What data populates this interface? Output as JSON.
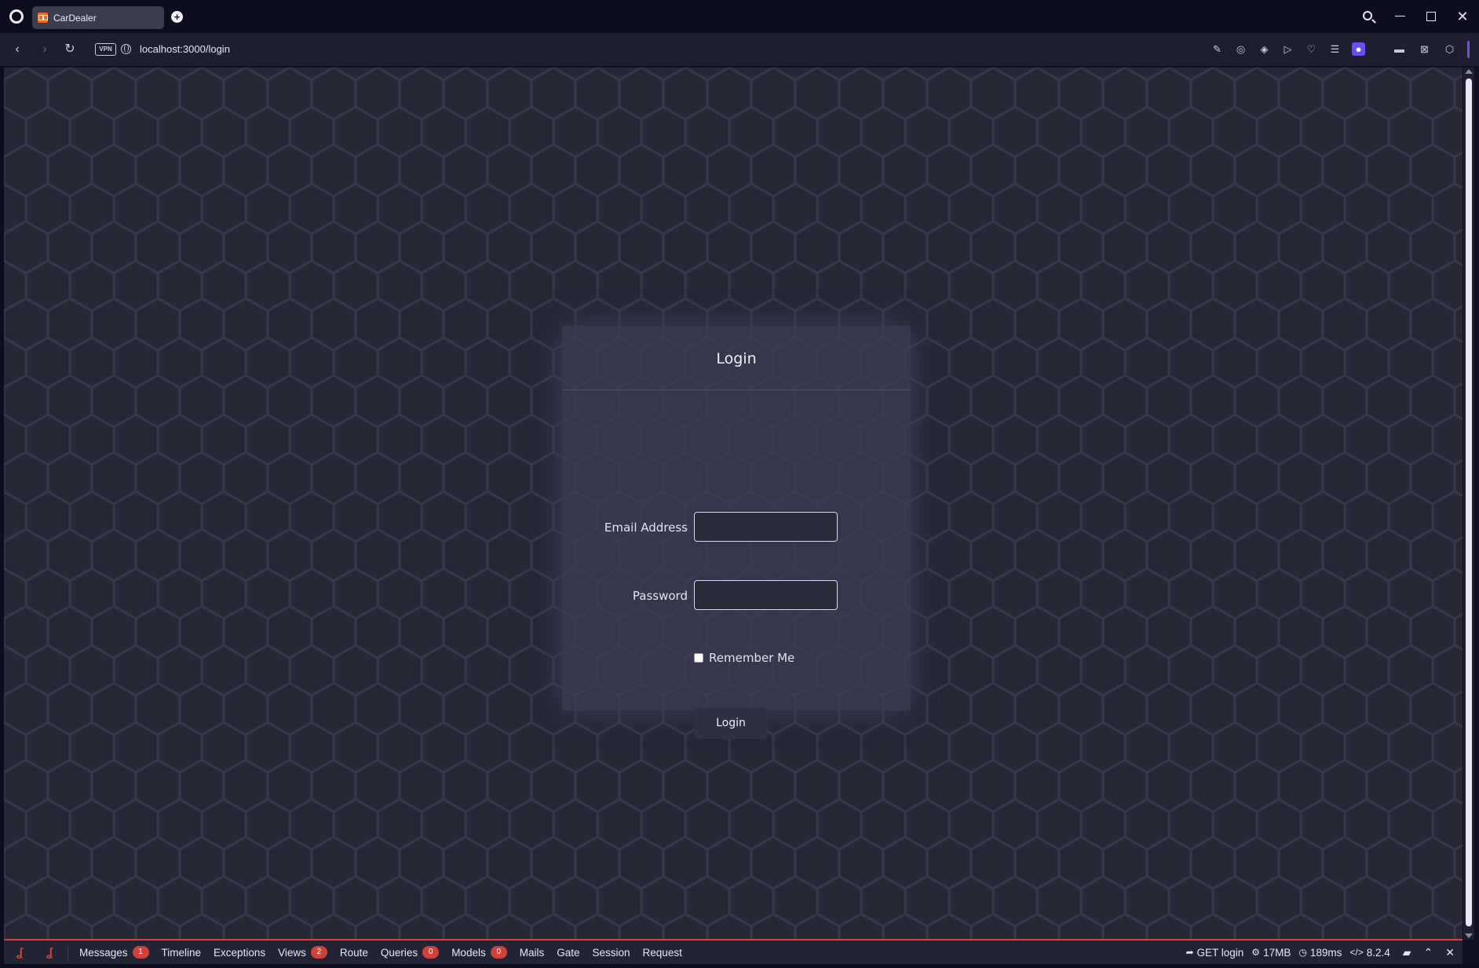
{
  "browser": {
    "tab_title": "CarDealer",
    "new_tab_symbol": "+",
    "url": "localhost:3000/login",
    "vpn_label": "VPN",
    "toolbar_icons": [
      "snapshot-icon",
      "camera-icon",
      "shield-icon",
      "send-icon",
      "heart-icon",
      "easy-setup-icon",
      "profile-icon"
    ],
    "extra_icons": [
      "sidebar-icon",
      "ai-icon",
      "box-icon"
    ]
  },
  "login": {
    "title": "Login",
    "email_label": "Email Address",
    "email_value": "",
    "password_label": "Password",
    "password_value": "",
    "remember_label": "Remember Me",
    "remember_checked": false,
    "submit_label": "Login"
  },
  "debugbar": {
    "tabs": [
      {
        "label": "Messages",
        "badge": "1"
      },
      {
        "label": "Timeline",
        "badge": null
      },
      {
        "label": "Exceptions",
        "badge": null
      },
      {
        "label": "Views",
        "badge": "2"
      },
      {
        "label": "Route",
        "badge": null
      },
      {
        "label": "Queries",
        "badge": "0"
      },
      {
        "label": "Models",
        "badge": "0"
      },
      {
        "label": "Mails",
        "badge": null
      },
      {
        "label": "Gate",
        "badge": null
      },
      {
        "label": "Session",
        "badge": null
      },
      {
        "label": "Request",
        "badge": null
      }
    ],
    "route": "GET login",
    "memory": "17MB",
    "time": "189ms",
    "php_version": "8.2.4",
    "accent_color": "#d3403c"
  }
}
